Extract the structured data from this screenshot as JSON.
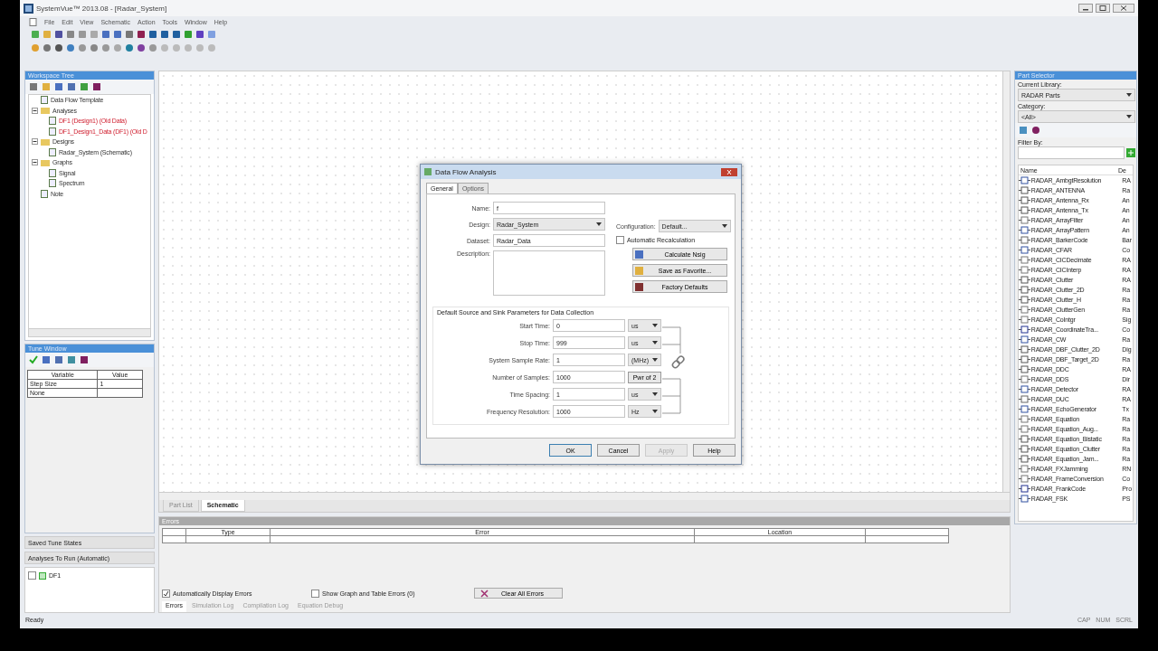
{
  "window": {
    "title": "SystemVue™ 2013.08 - [Radar_System]"
  },
  "menu": [
    "File",
    "Edit",
    "View",
    "Schematic",
    "Action",
    "Tools",
    "Window",
    "Help"
  ],
  "workspace_tree": {
    "title": "Workspace Tree",
    "items": [
      {
        "label": "Data Flow Template",
        "stale": false
      },
      {
        "label": "Analyses",
        "stale": false,
        "expanded": true,
        "children": [
          {
            "label": "DF1 (Design1) (Old Data)",
            "stale": true
          },
          {
            "label": "DF1_Design1_Data (DF1) (Old D",
            "stale": true
          }
        ]
      },
      {
        "label": "Designs",
        "stale": false,
        "expanded": true,
        "children": [
          {
            "label": "Radar_System (Schematic)",
            "stale": false
          }
        ]
      },
      {
        "label": "Graphs",
        "stale": false,
        "expanded": true,
        "children": [
          {
            "label": "Signal",
            "stale": false
          },
          {
            "label": "Spectrum",
            "stale": false
          }
        ]
      },
      {
        "label": "Note",
        "stale": false
      }
    ]
  },
  "tune_window": {
    "title": "Tune Window",
    "columns": [
      "Variable",
      "Value"
    ],
    "rows": [
      {
        "variable": "Step Size",
        "value": "1"
      },
      {
        "variable": "None"
      }
    ]
  },
  "saved_tune_states": {
    "title": "Saved Tune States"
  },
  "analyses_to_run": {
    "title": "Analyses To Run (Automatic)",
    "items": [
      {
        "label": "DF1",
        "checked": false
      }
    ]
  },
  "schematic": {
    "tabs": [
      {
        "label": "Part List",
        "selected": false
      },
      {
        "label": "Schematic",
        "selected": true
      }
    ]
  },
  "dialog": {
    "title": "Data Flow Analysis",
    "tabs": [
      {
        "label": "General",
        "selected": true
      },
      {
        "label": "Options",
        "selected": false
      }
    ],
    "name": {
      "label": "Name:",
      "value": "f"
    },
    "design": {
      "label": "Design:",
      "value": "Radar_System"
    },
    "configuration": {
      "label": "Configuration:",
      "value": "Default..."
    },
    "dataset": {
      "label": "Dataset:",
      "value": "Radar_Data"
    },
    "auto_recalc": {
      "label": "Automatic Recalculation",
      "checked": false
    },
    "description": {
      "label": "Description:"
    },
    "side_buttons": [
      "Calculate Nsig",
      "Save as Favorite...",
      "Factory Defaults"
    ],
    "group_title": "Default Source and Sink Parameters for Data Collection",
    "params": [
      {
        "label": "Start Time:",
        "value": "0",
        "unit": "us",
        "kind": "dropdown"
      },
      {
        "label": "Stop Time:",
        "value": "999",
        "unit": "us",
        "kind": "dropdown"
      },
      {
        "label": "System Sample Rate:",
        "value": "1",
        "unit": "(MHz)",
        "kind": "dropdown"
      },
      {
        "label": "Number of Samples:",
        "value": "1000",
        "unit": "Pwr of 2",
        "kind": "button"
      },
      {
        "label": "Time Spacing:",
        "value": "1",
        "unit": "us",
        "kind": "dropdown"
      },
      {
        "label": "Frequency Resolution:",
        "value": "1000",
        "unit": "Hz",
        "kind": "dropdown"
      }
    ],
    "buttons": [
      {
        "label": "OK",
        "disabled": false
      },
      {
        "label": "Cancel",
        "disabled": false
      },
      {
        "label": "Apply",
        "disabled": true
      },
      {
        "label": "Help",
        "disabled": false
      }
    ]
  },
  "errors": {
    "title": "Errors",
    "columns": [
      "Type",
      "Error",
      "Location"
    ],
    "auto_display": {
      "label": "Automatically Display Errors",
      "checked": true
    },
    "show_graph": {
      "label": "Show Graph and Table Errors (0)",
      "checked": false
    },
    "clear_button": "Clear All Errors",
    "tabs": [
      {
        "label": "Errors",
        "selected": true
      },
      {
        "label": "Simulation Log",
        "selected": false
      },
      {
        "label": "Compilation Log",
        "selected": false
      },
      {
        "label": "Equation Debug",
        "selected": false
      }
    ]
  },
  "part_selector": {
    "title": "Part Selector",
    "library_label": "Current Library:",
    "library": "RADAR Parts",
    "category_label": "Category:",
    "category": "<All>",
    "filter_label": "Filter By:",
    "columns": [
      "Name",
      "De"
    ],
    "parts": [
      {
        "name": "RADAR_AmbgtResolution",
        "desc": "RA"
      },
      {
        "name": "RADAR_ANTENNA",
        "desc": "Ra"
      },
      {
        "name": "RADAR_Antenna_Rx",
        "desc": "An"
      },
      {
        "name": "RADAR_Antenna_Tx",
        "desc": "An"
      },
      {
        "name": "RADAR_ArrayFilter",
        "desc": "An"
      },
      {
        "name": "RADAR_ArrayPattern",
        "desc": "An"
      },
      {
        "name": "RADAR_BarkerCode",
        "desc": "Bar"
      },
      {
        "name": "RADAR_CFAR",
        "desc": "Co"
      },
      {
        "name": "RADAR_CICDecimate",
        "desc": "RA"
      },
      {
        "name": "RADAR_CICInterp",
        "desc": "RA"
      },
      {
        "name": "RADAR_Clutter",
        "desc": "RA"
      },
      {
        "name": "RADAR_Clutter_2D",
        "desc": "Ra"
      },
      {
        "name": "RADAR_Clutter_H",
        "desc": "Ra"
      },
      {
        "name": "RADAR_ClutterGen",
        "desc": "Ra"
      },
      {
        "name": "RADAR_CoIntgr",
        "desc": "Sig"
      },
      {
        "name": "RADAR_CoordinateTra...",
        "desc": "Co"
      },
      {
        "name": "RADAR_CW",
        "desc": "Ra"
      },
      {
        "name": "RADAR_DBF_Clutter_2D",
        "desc": "Dig"
      },
      {
        "name": "RADAR_DBF_Target_2D",
        "desc": "Ra"
      },
      {
        "name": "RADAR_DDC",
        "desc": "RA"
      },
      {
        "name": "RADAR_DDS",
        "desc": "Dir"
      },
      {
        "name": "RADAR_Detector",
        "desc": "RA"
      },
      {
        "name": "RADAR_DUC",
        "desc": "RA"
      },
      {
        "name": "RADAR_EchoGenerator",
        "desc": "Tx"
      },
      {
        "name": "RADAR_Equation",
        "desc": "Ra"
      },
      {
        "name": "RADAR_Equation_Aug...",
        "desc": "Ra"
      },
      {
        "name": "RADAR_Equation_Bistatic",
        "desc": "Ra"
      },
      {
        "name": "RADAR_Equation_Clutter",
        "desc": "Ra"
      },
      {
        "name": "RADAR_Equation_Jam...",
        "desc": "Ra"
      },
      {
        "name": "RADAR_FXJamming",
        "desc": "RN"
      },
      {
        "name": "RADAR_FrameConversion",
        "desc": "Co"
      },
      {
        "name": "RADAR_FrankCode",
        "desc": "Pro"
      },
      {
        "name": "RADAR_FSK",
        "desc": "PS"
      }
    ]
  },
  "status_bar": {
    "text": "Ready",
    "indicators": [
      "CAP",
      "NUM",
      "SCRL"
    ]
  }
}
